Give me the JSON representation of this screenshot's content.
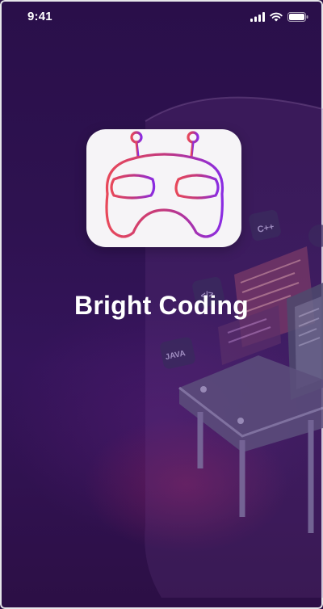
{
  "status_bar": {
    "time": "9:41",
    "icons": [
      "signal-icon",
      "wifi-icon",
      "battery-icon"
    ]
  },
  "splash": {
    "app_name": "Bright Coding",
    "logo_icon": "robot-gamepad-logo-icon"
  },
  "illustration": {
    "badges": [
      "C++",
      "</>",
      "JAVA"
    ]
  },
  "colors": {
    "background": "#2e1250",
    "logo_gradient_start": "#e8485a",
    "logo_gradient_end": "#8a2be2",
    "title": "#ffffff"
  }
}
